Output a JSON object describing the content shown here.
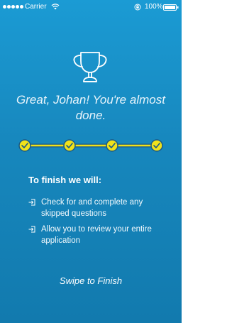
{
  "status_bar": {
    "carrier": "Carrier",
    "time": "",
    "battery": "100%"
  },
  "header": {
    "headline": "Great, Johan! You're almost done."
  },
  "progress": {
    "total_steps": 4,
    "completed_steps": 4,
    "track_color": "#f0e21b",
    "check_color": "#1a5a86"
  },
  "finish": {
    "title": "To finish we will:",
    "items": [
      {
        "text": "Check for and complete any skipped questions",
        "icon": "arrow-into-box-icon"
      },
      {
        "text": "Allow you to review your entire application",
        "icon": "arrow-into-box-icon"
      }
    ],
    "action_label": "Swipe to Finish"
  },
  "icons": {
    "trophy": "trophy-icon",
    "wifi": "wifi-icon",
    "battery": "battery-icon",
    "orientation": "orientation-lock-icon"
  },
  "colors": {
    "background_top": "#1b9bd4",
    "background_bottom": "#127aae",
    "text": "#ffffff"
  }
}
